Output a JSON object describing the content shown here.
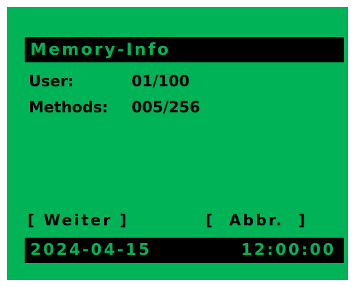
{
  "screen": {
    "title": "Memory-Info",
    "rows": [
      {
        "label": "User:",
        "value": "01/100"
      },
      {
        "label": "Methods:",
        "value": "005/256"
      }
    ],
    "softkeys": {
      "left": "[ Weiter ]",
      "right": "[  Abbr.  ]"
    },
    "status": {
      "date": "2024-04-15",
      "time": "12:00:00"
    }
  },
  "colors": {
    "screen_background": "#00b356",
    "bar_background": "#000000",
    "text": "#000000"
  }
}
